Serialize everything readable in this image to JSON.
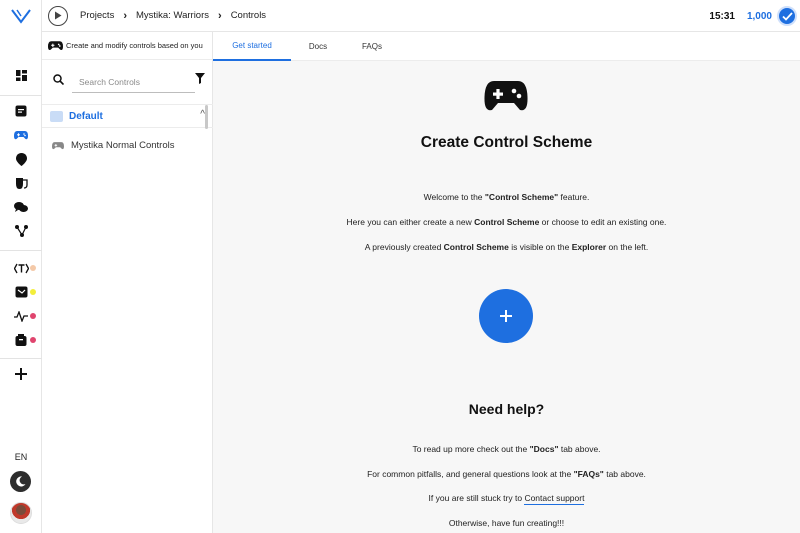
{
  "topbar": {
    "breadcrumbs": [
      "Projects",
      "Mystika: Warriors",
      "Controls"
    ],
    "time": "15:31",
    "credits": "1,000"
  },
  "explorer": {
    "header": "Create and modify controls based on you",
    "search_placeholder": "Search Controls",
    "folder": "Default",
    "items": [
      "Mystika Normal Controls"
    ]
  },
  "tabs": [
    "Get started",
    "Docs",
    "FAQs"
  ],
  "main": {
    "title": "Create Control Scheme",
    "line1": [
      "Welcome to the ",
      "\"Control Scheme\"",
      " feature."
    ],
    "line2": [
      "Here you can either create a new ",
      "Control Scheme",
      " or choose to edit an existing one."
    ],
    "line3": [
      "A previously created ",
      "Control Scheme",
      " is visible on the ",
      "Explorer",
      " on the left."
    ],
    "help_title": "Need help?",
    "help1": [
      "To read up more check out the ",
      "\"Docs\"",
      " tab above."
    ],
    "help2": [
      "For common pitfalls, and general questions look at the ",
      "\"FAQs\"",
      " tab above."
    ],
    "help3": [
      "If you are still stuck try to ",
      "Contact support"
    ],
    "help4": "Otherwise, have fun creating!!!"
  },
  "rail": {
    "language": "EN",
    "icons": [
      "logo-icon",
      "dashboard-icon",
      "notes-icon",
      "gamepad-icon",
      "map-pin-icon",
      "mask-icon",
      "chat-icon",
      "nodes-icon",
      "text-icon",
      "media-icon",
      "pulse-icon",
      "box-icon",
      "plus-icon",
      "moon-icon"
    ],
    "status_colors": {
      "text": "#f4c9a8",
      "media": "#f3ee3a",
      "pulse": "#e0456e",
      "box": "#e0456e"
    }
  },
  "colors": {
    "accent": "#1e6fe0"
  }
}
